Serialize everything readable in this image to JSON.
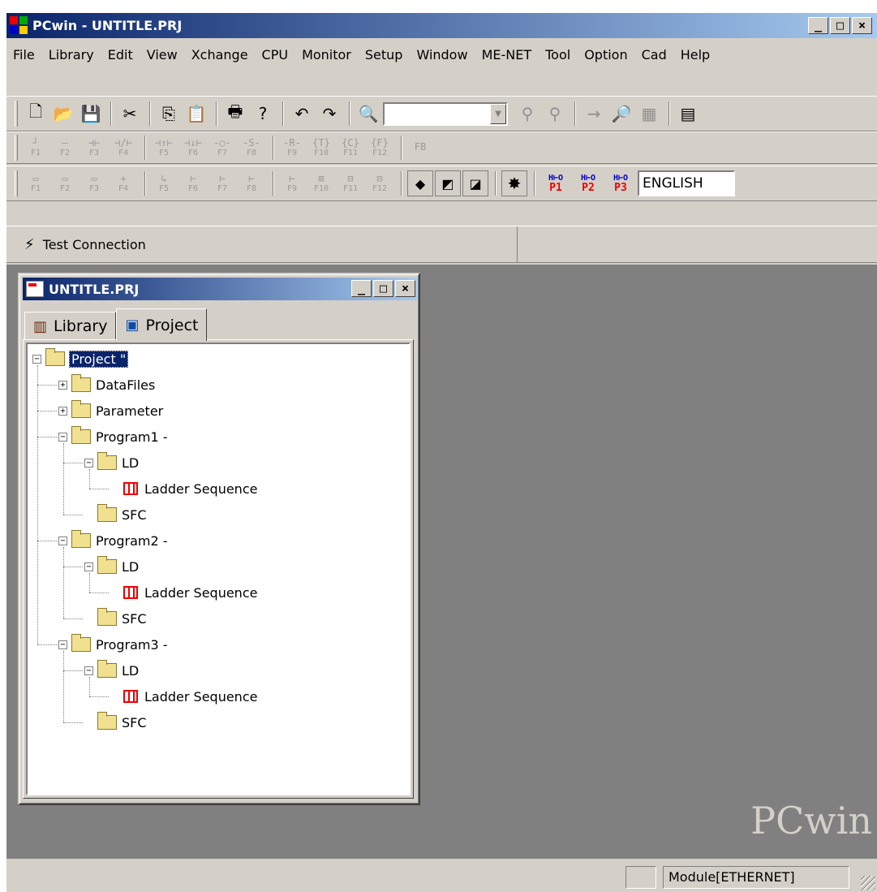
{
  "window": {
    "title": "PCwin - UNTITLE.PRJ"
  },
  "menu": [
    {
      "label": "File"
    },
    {
      "label": "Library"
    },
    {
      "label": "Edit"
    },
    {
      "label": "View"
    },
    {
      "label": "Xchange"
    },
    {
      "label": "CPU"
    },
    {
      "label": "Monitor"
    },
    {
      "label": "Setup"
    },
    {
      "label": "Window"
    },
    {
      "label": "ME-NET"
    },
    {
      "label": "Tool"
    },
    {
      "label": "Option"
    },
    {
      "label": "Cad"
    },
    {
      "label": "Help"
    }
  ],
  "toolbar1": {
    "icons": [
      "new-icon",
      "open-icon",
      "save-icon",
      "cut-icon",
      "copy-icon",
      "paste-icon",
      "print-icon",
      "help-icon",
      "undo-icon",
      "redo-icon",
      "find-icon",
      "find-device-icon",
      "replace-icon",
      "goto-icon",
      "zoom-icon",
      "grid-icon",
      "ladder-icon"
    ],
    "combo_value": ""
  },
  "toolbar2": {
    "keys": [
      {
        "glyph": "┘",
        "label": "F1"
      },
      {
        "glyph": "—",
        "label": "F2"
      },
      {
        "glyph": "⊣⊢",
        "label": "F3"
      },
      {
        "glyph": "⊣/⊢",
        "label": "F4"
      },
      {
        "glyph": "⊣↑⊢",
        "label": "F5"
      },
      {
        "glyph": "⊣↓⊢",
        "label": "F6"
      },
      {
        "glyph": "-○-",
        "label": "F7"
      },
      {
        "glyph": "-S-",
        "label": "F8"
      },
      {
        "glyph": "-R-",
        "label": "F9"
      },
      {
        "glyph": "{T}",
        "label": "F10"
      },
      {
        "glyph": "{C}",
        "label": "F11"
      },
      {
        "glyph": "{F}",
        "label": "F12"
      },
      {
        "glyph": "FB",
        "label": ""
      }
    ]
  },
  "toolbar3": {
    "keys": [
      {
        "glyph": "▭",
        "label": "F1"
      },
      {
        "glyph": "▭",
        "label": "F2"
      },
      {
        "glyph": "▭",
        "label": "F3"
      },
      {
        "glyph": "+",
        "label": "F4"
      },
      {
        "glyph": "↳",
        "label": "F5"
      },
      {
        "glyph": "⊢",
        "label": "F6"
      },
      {
        "glyph": "⊢",
        "label": "F7"
      },
      {
        "glyph": "⊢",
        "label": "F8"
      },
      {
        "glyph": "⊢",
        "label": "F9"
      },
      {
        "glyph": "⊞",
        "label": "F10"
      },
      {
        "glyph": "⊟",
        "label": "F11"
      },
      {
        "glyph": "⊟",
        "label": "F12"
      }
    ],
    "p_buttons": [
      {
        "top": "H⊢O",
        "bottom": "P1"
      },
      {
        "top": "H⊢O",
        "bottom": "P2"
      },
      {
        "top": "H⊢O",
        "bottom": "P3"
      }
    ],
    "language": "ENGLISH"
  },
  "connection": {
    "label": "Test Connection"
  },
  "watermark": "PCwin",
  "project_window": {
    "title": "UNTITLE.PRJ",
    "tabs": [
      {
        "label": "Library"
      },
      {
        "label": "Project"
      }
    ],
    "active_tab": "Project",
    "tree": [
      {
        "label": "Project \"",
        "depth": 0,
        "expander": "−",
        "icon": "open-folder-icon",
        "selected": true
      },
      {
        "label": "DataFiles",
        "depth": 1,
        "expander": "+",
        "icon": "folder-icon"
      },
      {
        "label": "Parameter",
        "depth": 1,
        "expander": "+",
        "icon": "folder-icon"
      },
      {
        "label": "Program1 -",
        "depth": 1,
        "expander": "−",
        "icon": "folder-icon"
      },
      {
        "label": "LD",
        "depth": 2,
        "expander": "−",
        "icon": "folder-icon"
      },
      {
        "label": "Ladder Sequence",
        "depth": 3,
        "expander": "",
        "icon": "ladder-icon"
      },
      {
        "label": "SFC",
        "depth": 2,
        "expander": "",
        "icon": "folder-icon"
      },
      {
        "label": "Program2 -",
        "depth": 1,
        "expander": "−",
        "icon": "folder-icon"
      },
      {
        "label": "LD",
        "depth": 2,
        "expander": "−",
        "icon": "folder-icon"
      },
      {
        "label": "Ladder Sequence",
        "depth": 3,
        "expander": "",
        "icon": "ladder-icon"
      },
      {
        "label": "SFC",
        "depth": 2,
        "expander": "",
        "icon": "folder-icon"
      },
      {
        "label": "Program3 -",
        "depth": 1,
        "expander": "−",
        "icon": "folder-icon"
      },
      {
        "label": "LD",
        "depth": 2,
        "expander": "−",
        "icon": "folder-icon"
      },
      {
        "label": "Ladder Sequence",
        "depth": 3,
        "expander": "",
        "icon": "ladder-icon"
      },
      {
        "label": "SFC",
        "depth": 2,
        "expander": "",
        "icon": "folder-icon"
      }
    ]
  },
  "statusbar": {
    "left_panel": "",
    "module": "Module[ETHERNET]"
  }
}
